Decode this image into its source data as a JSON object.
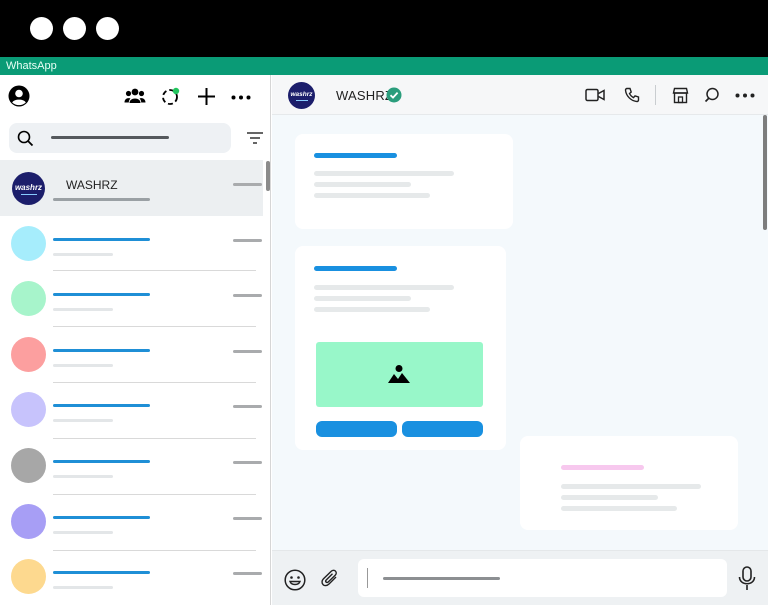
{
  "window": {
    "app_title": "WhatsApp"
  },
  "sidebar": {
    "search": {
      "placeholder": ""
    },
    "chats": [
      {
        "name": "WASHRZ",
        "avatar_logo_text": "washrz",
        "avatar_color": "#1c1e6b",
        "active": true
      },
      {
        "name": "",
        "avatar_color": "#a6edfc"
      },
      {
        "name": "",
        "avatar_color": "#a7f4cb"
      },
      {
        "name": "",
        "avatar_color": "#fc9f9f"
      },
      {
        "name": "",
        "avatar_color": "#c7c3fc"
      },
      {
        "name": "",
        "avatar_color": "#a7a7a7"
      },
      {
        "name": "",
        "avatar_color": "#a79ef5"
      },
      {
        "name": "",
        "avatar_color": "#fdd98f"
      }
    ]
  },
  "conversation": {
    "contact_name": "WASHRZ",
    "contact_logo_text": "washrz",
    "verified": true
  },
  "colors": {
    "titlebar": "#0a9b76",
    "accent_blue": "#1f8fd6",
    "image_placeholder": "#98f7c9",
    "outgoing_bar": "#f7c8ee",
    "online_dot": "#22c55e",
    "verified_badge": "#2a9d7c"
  }
}
